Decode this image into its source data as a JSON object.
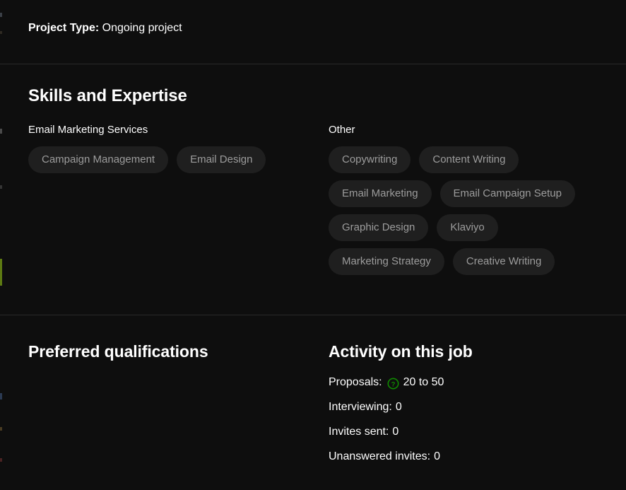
{
  "theme": {
    "background": "#0e0e0e",
    "divider": "#2a2a2a",
    "text_primary": "#ffffff",
    "pill_background": "#1f1f1f",
    "pill_text": "#9c9c9c",
    "accent_green": "#108a00"
  },
  "project_type": {
    "label": "Project Type:",
    "value": "Ongoing project"
  },
  "skills_section": {
    "heading": "Skills and Expertise",
    "groups": [
      {
        "label": "Email Marketing Services",
        "skills": [
          "Campaign Management",
          "Email Design"
        ]
      },
      {
        "label": "Other",
        "skills": [
          "Copywriting",
          "Content Writing",
          "Email Marketing",
          "Email Campaign Setup",
          "Graphic Design",
          "Klaviyo",
          "Marketing Strategy",
          "Creative Writing"
        ]
      }
    ]
  },
  "qualifications_section": {
    "heading": "Preferred qualifications"
  },
  "activity_section": {
    "heading": "Activity on this job",
    "help_icon": "question-mark-circle-icon",
    "stats": [
      {
        "label": "Proposals:",
        "value": "20 to 50",
        "has_help_icon": true
      },
      {
        "label": "Interviewing:",
        "value": "0",
        "has_help_icon": false
      },
      {
        "label": "Invites sent:",
        "value": "0",
        "has_help_icon": false
      },
      {
        "label": "Unanswered invites:",
        "value": "0",
        "has_help_icon": false
      }
    ]
  }
}
